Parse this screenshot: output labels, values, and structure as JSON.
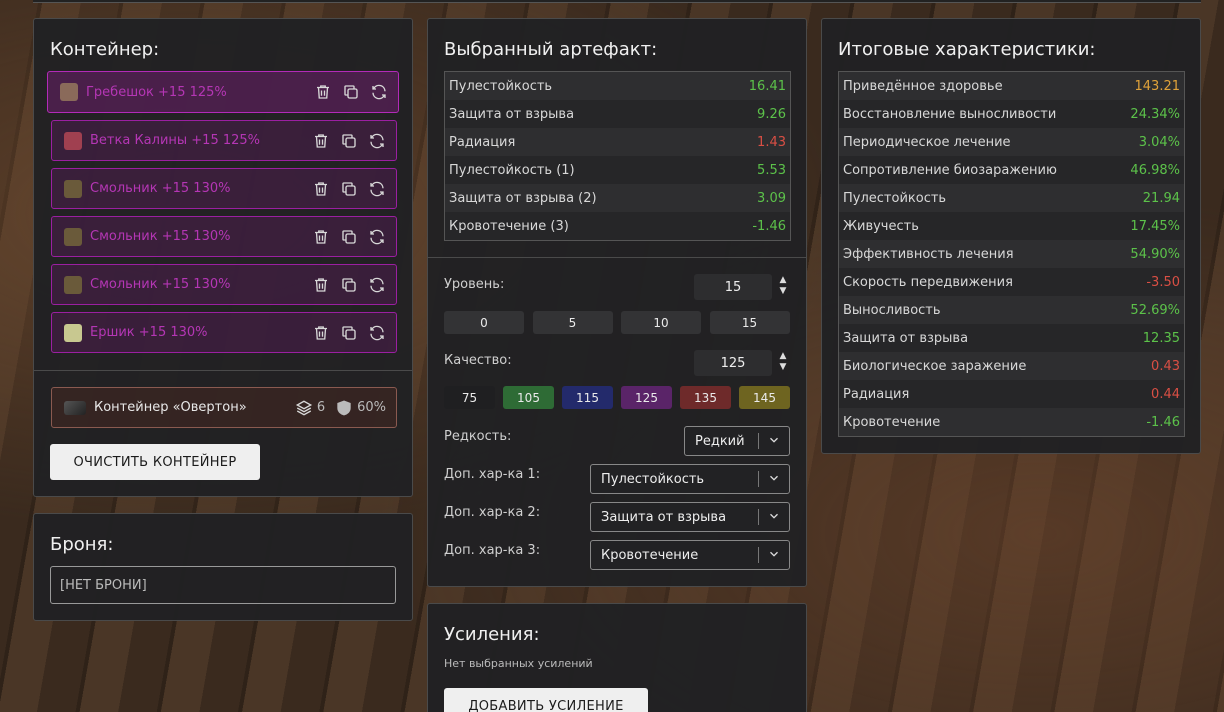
{
  "container_panel": {
    "title": "Контейнер:",
    "artifacts": [
      {
        "label": "Гребешок +15 125%",
        "icon": "grebeshok-icon",
        "icon_color": "#8a6a5a"
      },
      {
        "label": "Ветка Калины +15 125%",
        "icon": "vetka-kaliny-icon",
        "icon_color": "#a04050"
      },
      {
        "label": "Смольник +15 130%",
        "icon": "smolnik-icon",
        "icon_color": "#6a5a3a"
      },
      {
        "label": "Смольник +15 130%",
        "icon": "smolnik-icon",
        "icon_color": "#6a5a3a"
      },
      {
        "label": "Смольник +15 130%",
        "icon": "smolnik-icon",
        "icon_color": "#6a5a3a"
      },
      {
        "label": "Ершик +15 130%",
        "icon": "ershik-icon",
        "icon_color": "#c8c890"
      }
    ],
    "container_item": {
      "name": "Контейнер «Овертон»",
      "slots": "6",
      "protection": "60%"
    },
    "clear_button": "ОЧИСТИТЬ КОНТЕЙНЕР"
  },
  "armor_panel": {
    "title": "Броня:",
    "value": "[НЕТ БРОНИ]"
  },
  "selected_panel": {
    "title": "Выбранный артефакт:",
    "stats": [
      {
        "name": "Пулестойкость",
        "value": "16.41",
        "color": "green"
      },
      {
        "name": "Защита от взрыва",
        "value": "9.26",
        "color": "green"
      },
      {
        "name": "Радиация",
        "value": "1.43",
        "color": "red"
      },
      {
        "name": "Пулестойкость (1)",
        "value": "5.53",
        "color": "green"
      },
      {
        "name": "Защита от взрыва (2)",
        "value": "3.09",
        "color": "green"
      },
      {
        "name": "Кровотечение (3)",
        "value": "-1.46",
        "color": "green"
      }
    ],
    "level_label": "Уровень:",
    "level_value": "15",
    "level_presets": [
      "0",
      "5",
      "10",
      "15"
    ],
    "quality_label": "Качество:",
    "quality_value": "125",
    "quality_presets": [
      {
        "label": "75",
        "color": "#1f1f21"
      },
      {
        "label": "105",
        "color": "#2e6b35"
      },
      {
        "label": "115",
        "color": "#232a6b"
      },
      {
        "label": "125",
        "color": "#5a2468"
      },
      {
        "label": "135",
        "color": "#6e2a2a"
      },
      {
        "label": "145",
        "color": "#6e6420"
      }
    ],
    "rarity_label": "Редкость:",
    "rarity_value": "Редкий",
    "extra1_label": "Доп. хар-ка 1:",
    "extra1_value": "Пулестойкость",
    "extra2_label": "Доп. хар-ка 2:",
    "extra2_value": "Защита от взрыва",
    "extra3_label": "Доп. хар-ка 3:",
    "extra3_value": "Кровотечение"
  },
  "boost_panel": {
    "title": "Усиления:",
    "empty_text": "Нет выбранных усилений",
    "add_button": "ДОБАВИТЬ УСИЛЕНИЕ"
  },
  "totals_panel": {
    "title": "Итоговые характеристики:",
    "stats": [
      {
        "name": "Приведённое здоровье",
        "value": "143.21",
        "color": "orange"
      },
      {
        "name": "Восстановление выносливости",
        "value": "24.34%",
        "color": "green"
      },
      {
        "name": "Периодическое лечение",
        "value": "3.04%",
        "color": "green"
      },
      {
        "name": "Сопротивление биозаражению",
        "value": "46.98%",
        "color": "green"
      },
      {
        "name": "Пулестойкость",
        "value": "21.94",
        "color": "green"
      },
      {
        "name": "Живучесть",
        "value": "17.45%",
        "color": "green"
      },
      {
        "name": "Эффективность лечения",
        "value": "54.90%",
        "color": "green"
      },
      {
        "name": "Скорость передвижения",
        "value": "-3.50",
        "color": "red"
      },
      {
        "name": "Выносливость",
        "value": "52.69%",
        "color": "green"
      },
      {
        "name": "Защита от взрыва",
        "value": "12.35",
        "color": "green"
      },
      {
        "name": "Биологическое заражение",
        "value": "0.43",
        "color": "red"
      },
      {
        "name": "Радиация",
        "value": "0.44",
        "color": "red"
      },
      {
        "name": "Кровотечение",
        "value": "-1.46",
        "color": "green"
      }
    ]
  },
  "colors": {
    "accent_purple": "#9b1fa1",
    "green": "#5cc24a",
    "red": "#d94f44",
    "orange": "#e0a23a"
  }
}
